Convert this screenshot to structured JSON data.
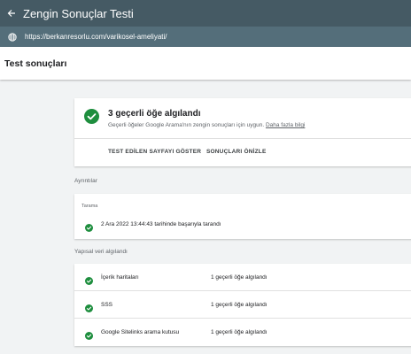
{
  "app": {
    "title": "Zengin Sonuçlar Testi",
    "url": "https://berkanresorlu.com/varikosel-ameliyati/"
  },
  "header": {
    "title": "Test sonuçları"
  },
  "summary": {
    "title": "3 geçerli öğe algılandı",
    "description": "Geçerli öğeler Google Arama'nın zengin sonuçları için uygun.",
    "learn_more": "Daha fazla bilgi",
    "show_page_button": "TEST EDİLEN SAYFAYI GÖSTER",
    "preview_button": "SONUÇLARI ÖNİZLE"
  },
  "details": {
    "label": "Ayrıntılar",
    "crawl_title": "Tarama",
    "crawl_status": "2 Ara 2022 13:44:43 tarihinde başarıyla tarandı"
  },
  "structured": {
    "label": "Yapısal veri algılandı",
    "items": [
      {
        "name": "İçerik haritaları",
        "count": "1 geçerli öğe algılandı"
      },
      {
        "name": "SSS",
        "count": "1 geçerli öğe algılandı"
      },
      {
        "name": "Google Sitelinks arama kutusu",
        "count": "1 geçerli öğe algılandı"
      }
    ]
  },
  "colors": {
    "topbar": "#455a64",
    "urlbar": "#546e7a",
    "success": "#1e8e3e"
  }
}
